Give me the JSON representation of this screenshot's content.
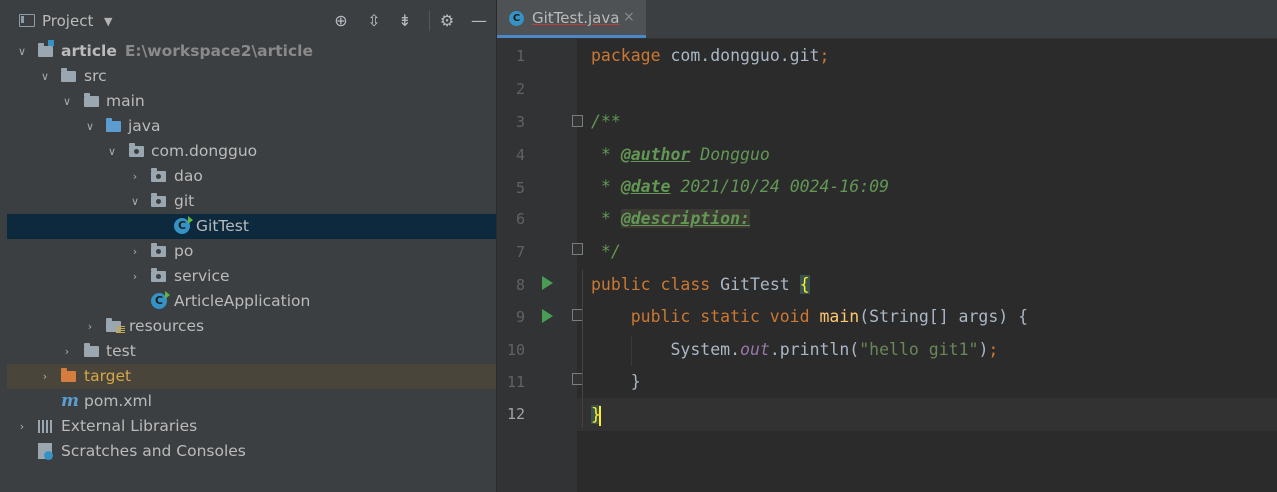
{
  "project_panel": {
    "title": "Project",
    "icons": [
      "locate-icon",
      "expand-all-icon",
      "collapse-all-icon",
      "settings-gear-icon",
      "hide-minus-icon"
    ],
    "tree": [
      {
        "label": "article",
        "detail": "E:\\workspace2\\article",
        "icon": "module-folder-icon",
        "expanded": true,
        "depth": 0
      },
      {
        "label": "src",
        "icon": "folder-icon",
        "expanded": true,
        "depth": 1
      },
      {
        "label": "main",
        "icon": "folder-icon",
        "expanded": true,
        "depth": 2
      },
      {
        "label": "java",
        "icon": "source-folder-icon",
        "expanded": true,
        "depth": 3
      },
      {
        "label": "com.dongguo",
        "icon": "package-icon",
        "expanded": true,
        "depth": 4
      },
      {
        "label": "dao",
        "icon": "package-icon",
        "expanded": false,
        "depth": 5
      },
      {
        "label": "git",
        "icon": "package-icon",
        "expanded": true,
        "depth": 5
      },
      {
        "label": "GitTest",
        "icon": "java-class-icon",
        "depth": 6,
        "selected": true
      },
      {
        "label": "po",
        "icon": "package-icon",
        "expanded": false,
        "depth": 5
      },
      {
        "label": "service",
        "icon": "package-icon",
        "expanded": false,
        "depth": 5
      },
      {
        "label": "ArticleApplication",
        "icon": "spring-boot-class-icon",
        "depth": 5
      },
      {
        "label": "resources",
        "icon": "resources-folder-icon",
        "expanded": false,
        "depth": 3
      },
      {
        "label": "test",
        "icon": "folder-icon",
        "expanded": false,
        "depth": 2
      },
      {
        "label": "target",
        "icon": "excluded-folder-icon",
        "expanded": false,
        "depth": 1
      },
      {
        "label": "pom.xml",
        "icon": "maven-icon",
        "depth": 1
      },
      {
        "label": "External Libraries",
        "icon": "libraries-icon",
        "expanded": false,
        "depth": 0
      },
      {
        "label": "Scratches and Consoles",
        "icon": "scratches-icon",
        "depth": 0
      }
    ]
  },
  "editor": {
    "tab": {
      "label": "GitTest.java",
      "close": "×"
    },
    "line_numbers": [
      "1",
      "2",
      "3",
      "4",
      "5",
      "6",
      "7",
      "8",
      "9",
      "10",
      "11",
      "12"
    ],
    "current_line": "12",
    "code": {
      "l1_kw": "package",
      "l1_txt": " com.dongguo.git",
      "l1_semi": ";",
      "l3": "/**",
      "l4_pre": " * ",
      "l4_tag": "@author",
      "l4_val": " Dongguo",
      "l5_pre": " * ",
      "l5_tag": "@date",
      "l5_val": " 2021/10/24 0024-16:09",
      "l6_pre": " * ",
      "l6_tag": "@description:",
      "l7": " */",
      "l8_kw": "public class",
      "l8_name": " GitTest ",
      "l8_brace": "{",
      "l9_kw": "    public static void",
      "l9_fn": " main",
      "l9_rest": "(String[] args) {",
      "l10_obj": "        System.",
      "l10_field": "out",
      "l10_call": ".println(",
      "l10_str": "\"hello git1\"",
      "l10_end": ")",
      "l10_semi": ";",
      "l11": "    }",
      "l12": "}"
    }
  }
}
